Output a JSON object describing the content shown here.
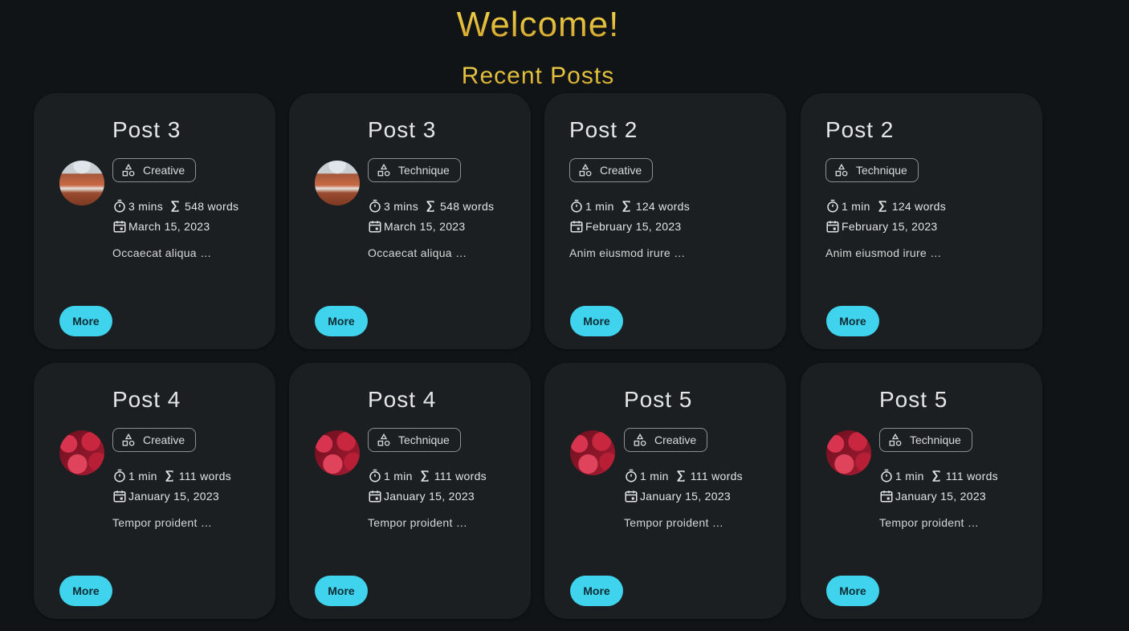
{
  "header": {
    "welcome": "Welcome!",
    "subtitle": "Recent Posts"
  },
  "colors": {
    "accent": "#3fd3ee",
    "title_gold": "#e0b93a",
    "card_bg": "#1b1f21",
    "page_bg": "#111416"
  },
  "posts": [
    {
      "title": "Post 3",
      "tag": "Creative",
      "reading_time": "3 mins",
      "word_count": "548 words",
      "date": "March 15, 2023",
      "excerpt": "Occaecat aliqua …",
      "more": "More",
      "avatar": "canyon"
    },
    {
      "title": "Post 3",
      "tag": "Technique",
      "reading_time": "3 mins",
      "word_count": "548 words",
      "date": "March 15, 2023",
      "excerpt": "Occaecat aliqua …",
      "more": "More",
      "avatar": "canyon"
    },
    {
      "title": "Post 2",
      "tag": "Creative",
      "reading_time": "1 min",
      "word_count": "124 words",
      "date": "February 15, 2023",
      "excerpt": "Anim eiusmod irure …",
      "more": "More",
      "avatar": ""
    },
    {
      "title": "Post 2",
      "tag": "Technique",
      "reading_time": "1 min",
      "word_count": "124 words",
      "date": "February 15, 2023",
      "excerpt": "Anim eiusmod irure …",
      "more": "More",
      "avatar": ""
    },
    {
      "title": "Post 4",
      "tag": "Creative",
      "reading_time": "1 min",
      "word_count": "111 words",
      "date": "January 15, 2023",
      "excerpt": "Tempor proident …",
      "more": "More",
      "avatar": "strawberries"
    },
    {
      "title": "Post 4",
      "tag": "Technique",
      "reading_time": "1 min",
      "word_count": "111 words",
      "date": "January 15, 2023",
      "excerpt": "Tempor proident …",
      "more": "More",
      "avatar": "strawberries"
    },
    {
      "title": "Post 5",
      "tag": "Creative",
      "reading_time": "1 min",
      "word_count": "111 words",
      "date": "January 15, 2023",
      "excerpt": "Tempor proident …",
      "more": "More",
      "avatar": "strawberries"
    },
    {
      "title": "Post 5",
      "tag": "Technique",
      "reading_time": "1 min",
      "word_count": "111 words",
      "date": "January 15, 2023",
      "excerpt": "Tempor proident …",
      "more": "More",
      "avatar": "strawberries"
    }
  ]
}
